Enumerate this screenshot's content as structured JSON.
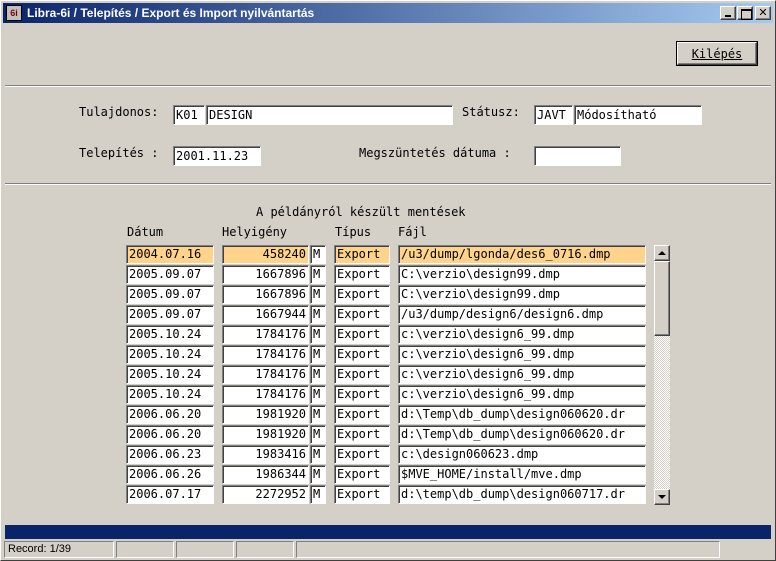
{
  "window": {
    "icon_text": "6i",
    "title": "Libra-6i / Telepítés / Export és Import nyilvántartás",
    "close_glyph": "✕"
  },
  "toolbar": {
    "exit_label": "Kilépés"
  },
  "form": {
    "owner_label": "Tulajdonos:",
    "owner_code": "K01",
    "owner_name": "DESIGN",
    "status_label": "Státusz:",
    "status_code": "JAVT",
    "status_name": "Módosítható",
    "install_label": "Telepítés :",
    "install_date": "2001.11.23",
    "end_label": "Megszüntetés dátuma :",
    "end_date": ""
  },
  "backups": {
    "title": "A példányról készült mentések",
    "headers": {
      "date": "Dátum",
      "size": "Helyigény",
      "type": "Típus",
      "file": "Fájl"
    },
    "rows": [
      {
        "date": "2004.07.16",
        "size": "458240",
        "unit": "M",
        "type": "Export",
        "file": "/u3/dump/lgonda/des6_0716.dmp"
      },
      {
        "date": "2005.09.07",
        "size": "1667896",
        "unit": "M",
        "type": "Export",
        "file": "C:\\verzio\\design99.dmp"
      },
      {
        "date": "2005.09.07",
        "size": "1667896",
        "unit": "M",
        "type": "Export",
        "file": "C:\\verzio\\design99.dmp"
      },
      {
        "date": "2005.09.07",
        "size": "1667944",
        "unit": "M",
        "type": "Export",
        "file": "/u3/dump/design6/design6.dmp"
      },
      {
        "date": "2005.10.24",
        "size": "1784176",
        "unit": "M",
        "type": "Export",
        "file": "c:\\verzio\\design6_99.dmp"
      },
      {
        "date": "2005.10.24",
        "size": "1784176",
        "unit": "M",
        "type": "Export",
        "file": "c:\\verzio\\design6_99.dmp"
      },
      {
        "date": "2005.10.24",
        "size": "1784176",
        "unit": "M",
        "type": "Export",
        "file": "c:\\verzio\\design6_99.dmp"
      },
      {
        "date": "2005.10.24",
        "size": "1784176",
        "unit": "M",
        "type": "Export",
        "file": "c:\\verzio\\design6_99.dmp"
      },
      {
        "date": "2006.06.20",
        "size": "1981920",
        "unit": "M",
        "type": "Export",
        "file": "d:\\Temp\\db_dump\\design060620.dr"
      },
      {
        "date": "2006.06.20",
        "size": "1981920",
        "unit": "M",
        "type": "Export",
        "file": "d:\\Temp\\db_dump\\design060620.dr"
      },
      {
        "date": "2006.06.23",
        "size": "1983416",
        "unit": "M",
        "type": "Export",
        "file": "c:\\design060623.dmp"
      },
      {
        "date": "2006.06.26",
        "size": "1986344",
        "unit": "M",
        "type": "Export",
        "file": "$MVE_HOME/install/mve.dmp"
      },
      {
        "date": "2006.07.17",
        "size": "2272952",
        "unit": "M",
        "type": "Export",
        "file": "d:\\temp\\db_dump\\design060717.dr"
      }
    ]
  },
  "status_bar": {
    "record": "Record: 1/39"
  },
  "colors": {
    "selected_row": "#ffd38a",
    "title_bar": "#0a246a",
    "face": "#d4d0c8"
  }
}
